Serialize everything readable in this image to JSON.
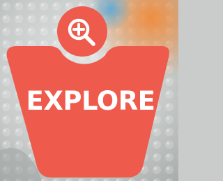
{
  "badge": {
    "label": "EXPLORE",
    "icon": "zoom-in-magnifier-icon"
  },
  "colors": {
    "badge_fill": "#ee5a4b",
    "icon_stroke": "#ffffff",
    "label_text": "#ffffff",
    "background": "#c9ccca"
  }
}
